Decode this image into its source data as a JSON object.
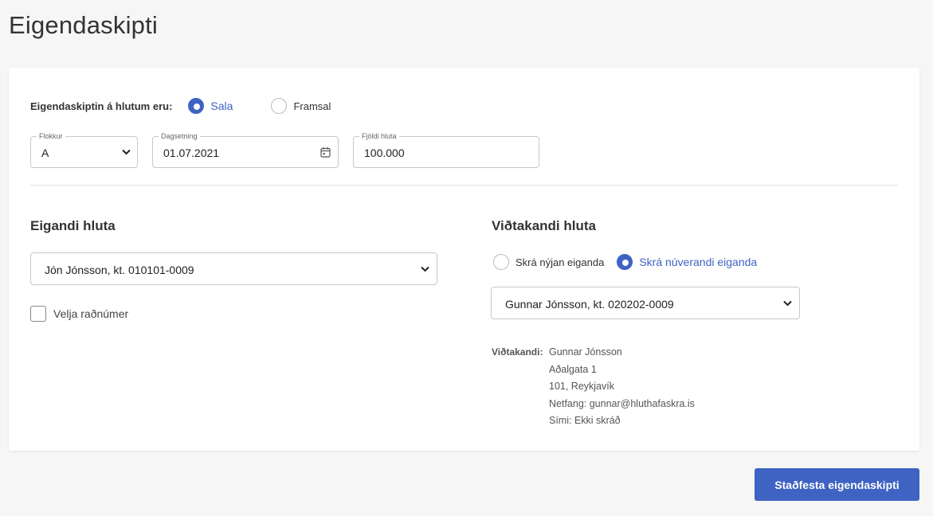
{
  "page": {
    "title": "Eigendaskipti"
  },
  "transfer_type": {
    "label": "Eigendaskiptin á hlutum eru:",
    "options": [
      {
        "label": "Sala",
        "selected": true
      },
      {
        "label": "Framsal",
        "selected": false
      }
    ]
  },
  "fields": {
    "class": {
      "label": "Flokkur",
      "value": "A"
    },
    "date": {
      "label": "Dagsetning",
      "value": "01.07.2021"
    },
    "count": {
      "label": "Fjöldi hluta",
      "value": "100.000"
    }
  },
  "owner": {
    "title": "Eigandi hluta",
    "selected": "Jón Jónsson, kt. 010101-0009",
    "choose_numbers_label": "Velja raðnúmer",
    "choose_numbers_checked": false
  },
  "receiver": {
    "title": "Viðtakandi hluta",
    "options": [
      {
        "label": "Skrá nýjan eiganda",
        "selected": false
      },
      {
        "label": "Skrá núverandi eiganda",
        "selected": true
      }
    ],
    "selected": "Gunnar Jónsson, kt. 020202-0009",
    "info_label": "Viðtakandi:",
    "info_lines": [
      "Gunnar Jónsson",
      "Aðalgata 1",
      "101, Reykjavík",
      "Netfang: gunnar@hluthafaskra.is",
      "Sími: Ekki skráð"
    ]
  },
  "actions": {
    "confirm_label": "Staðfesta eigendaskipti"
  },
  "colors": {
    "accent": "#3f63c2",
    "background": "#f6f6f6",
    "card": "#ffffff"
  },
  "icons": {
    "select_arrow": "chevron-down-icon",
    "date_picker": "calendar-icon"
  }
}
